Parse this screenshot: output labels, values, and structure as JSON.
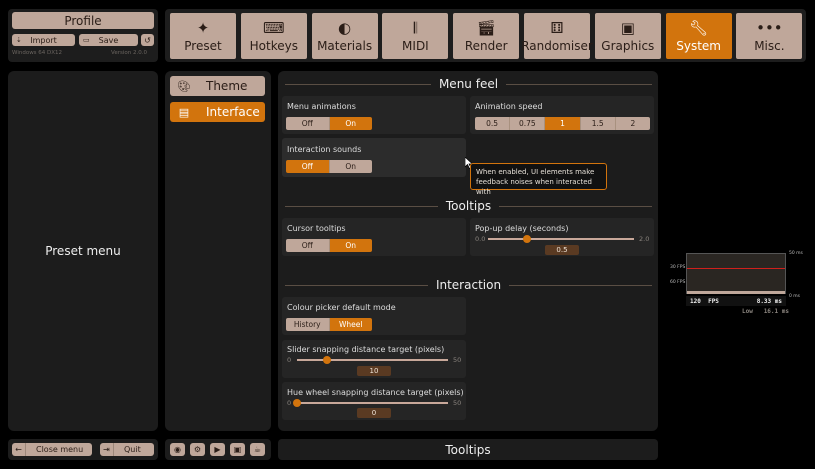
{
  "profile": {
    "title": "Profile",
    "import_label": "Import",
    "save_label": "Save",
    "os_label": "Windows 64 DX12",
    "version_label": "Version 2.0.0"
  },
  "tabs": [
    {
      "label": "Preset",
      "icon": "sparkle-icon"
    },
    {
      "label": "Hotkeys",
      "icon": "keyboard-icon"
    },
    {
      "label": "Materials",
      "icon": "material-icon"
    },
    {
      "label": "MIDI",
      "icon": "piano-icon"
    },
    {
      "label": "Render",
      "icon": "clapperboard-icon"
    },
    {
      "label": "Randomiser",
      "icon": "dice-icon"
    },
    {
      "label": "Graphics",
      "icon": "image-icon"
    },
    {
      "label": "System",
      "icon": "wrench-icon",
      "active": true
    },
    {
      "label": "Misc.",
      "icon": "ellipsis-icon"
    }
  ],
  "preset_menu": "Preset menu",
  "categories": [
    {
      "label": "Theme",
      "icon": "palette-icon"
    },
    {
      "label": "Interface",
      "icon": "window-icon",
      "active": true
    }
  ],
  "sections": {
    "menu_feel": "Menu feel",
    "tooltips": "Tooltips",
    "interaction": "Interaction"
  },
  "settings": {
    "menu_animations": {
      "label": "Menu animations",
      "options": [
        "Off",
        "On"
      ],
      "selected": "On"
    },
    "animation_speed": {
      "label": "Animation speed",
      "options": [
        "0.5",
        "0.75",
        "1",
        "1.5",
        "2"
      ],
      "selected": "1"
    },
    "interaction_sounds": {
      "label": "Interaction sounds",
      "options": [
        "Off",
        "On"
      ],
      "selected": "Off"
    },
    "cursor_tooltips": {
      "label": "Cursor tooltips",
      "options": [
        "Off",
        "On"
      ],
      "selected": "On"
    },
    "popup_delay": {
      "label": "Pop-up delay (seconds)",
      "min": "0.0",
      "max": "2.0",
      "value": "0.5"
    },
    "colour_picker_mode": {
      "label": "Colour picker default mode",
      "options": [
        "History",
        "Wheel"
      ],
      "selected": "Wheel"
    },
    "slider_snap": {
      "label": "Slider snapping distance target (pixels)",
      "min": "0",
      "max": "50",
      "value": "10"
    },
    "hue_snap": {
      "label": "Hue wheel snapping distance target (pixels)",
      "min": "0",
      "max": "50",
      "value": "0"
    }
  },
  "tooltip_text": "When enabled, UI elements make feedback noises when interacted with",
  "bottom": {
    "close_menu": "Close menu",
    "quit": "Quit",
    "tooltips_bar": "Tooltips"
  },
  "fps_overlay": {
    "axis_left": [
      "30 FPS",
      "60 FPS"
    ],
    "axis_right_top": "50 ms",
    "axis_right_bottom": "0 ms",
    "fps_value": "120",
    "fps_label": "FPS",
    "ms_value": "8.33 ms",
    "low_label": "Low",
    "low_value": "16.1 ms"
  },
  "colors": {
    "accent": "#d2740d",
    "button": "#bfa79a",
    "panel": "#1c1c1c",
    "background": "#000000"
  }
}
